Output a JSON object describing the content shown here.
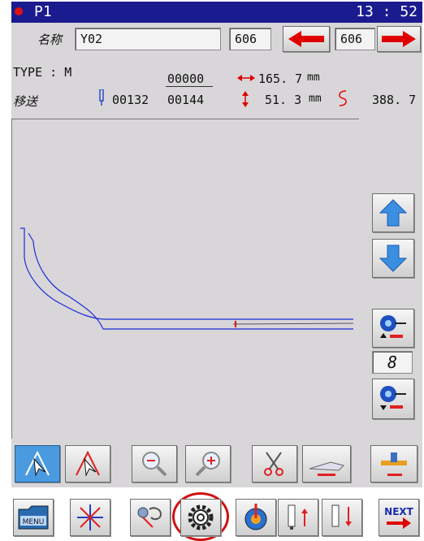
{
  "titlebar": {
    "screen": "P1",
    "clock": "13 : 52"
  },
  "header": {
    "name_label": "名称",
    "name_value": "Y02",
    "program_no": "606",
    "page_no": "606"
  },
  "status": {
    "type_label": "TYPE : M",
    "feed_label": "移送",
    "counter_top": "00000",
    "counter_left": "00132",
    "counter_right": "00144",
    "width_value": "165. 7",
    "width_unit": "mm",
    "height_value": "51. 3",
    "height_unit": "mm",
    "length_value": "388. 7"
  },
  "sidebar": {
    "step_value": "8"
  },
  "colors": {
    "title_bar": "#1a1b8e",
    "arrow_red": "#e00000",
    "pattern_line": "#1a2bd8",
    "active_tool": "#4a9ae0"
  },
  "icons": [
    "move-up-arrow-icon",
    "move-down-arrow-icon",
    "feed-forward-icon",
    "feed-backward-icon",
    "select-tool-icon",
    "pattern-tool-icon",
    "zoom-out-icon",
    "zoom-in-icon",
    "scissors-icon",
    "presser-foot-icon",
    "needle-stop-icon",
    "menu-folder-icon",
    "origin-icon",
    "user-tool-icon",
    "settings-gear-icon",
    "thread-tension-icon",
    "needle-up-icon",
    "needle-down-icon",
    "next-icon"
  ],
  "bottom": {
    "next_label": "NEXT"
  }
}
